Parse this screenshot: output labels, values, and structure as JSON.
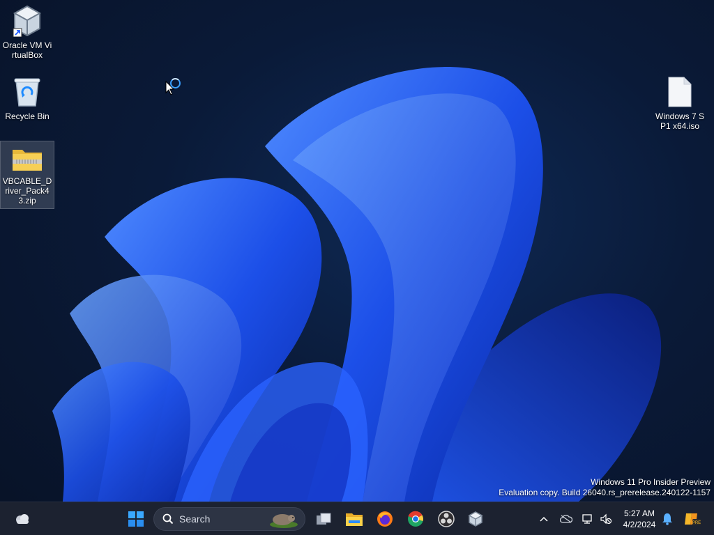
{
  "desktop": {
    "icons": [
      {
        "label": "Oracle VM VirtualBox",
        "icon": "virtualbox-icon"
      },
      {
        "label": "Recycle Bin",
        "icon": "recycle-bin-icon"
      },
      {
        "label": "VBCABLE_Driver_Pack43.zip",
        "icon": "zip-folder-icon"
      },
      {
        "label": "Windows 7 SP1 x64.iso",
        "icon": "iso-file-icon"
      }
    ]
  },
  "watermark": {
    "line1": "Windows 11 Pro Insider Preview",
    "line2": "Evaluation copy. Build 26040.rs_prerelease.240122-1157"
  },
  "taskbar": {
    "search_label": "Search",
    "pinned": [
      "start-icon",
      "task-view-icon",
      "file-explorer-icon",
      "firefox-icon",
      "chrome-icon",
      "obs-icon",
      "virtualbox-icon"
    ],
    "tray": {
      "time": "5:27 AM",
      "date": "4/2/2024"
    }
  },
  "colors": {
    "accent": "#1e5bff",
    "taskbar": "#1c2230",
    "desktop_bg": "#0a1a38"
  }
}
